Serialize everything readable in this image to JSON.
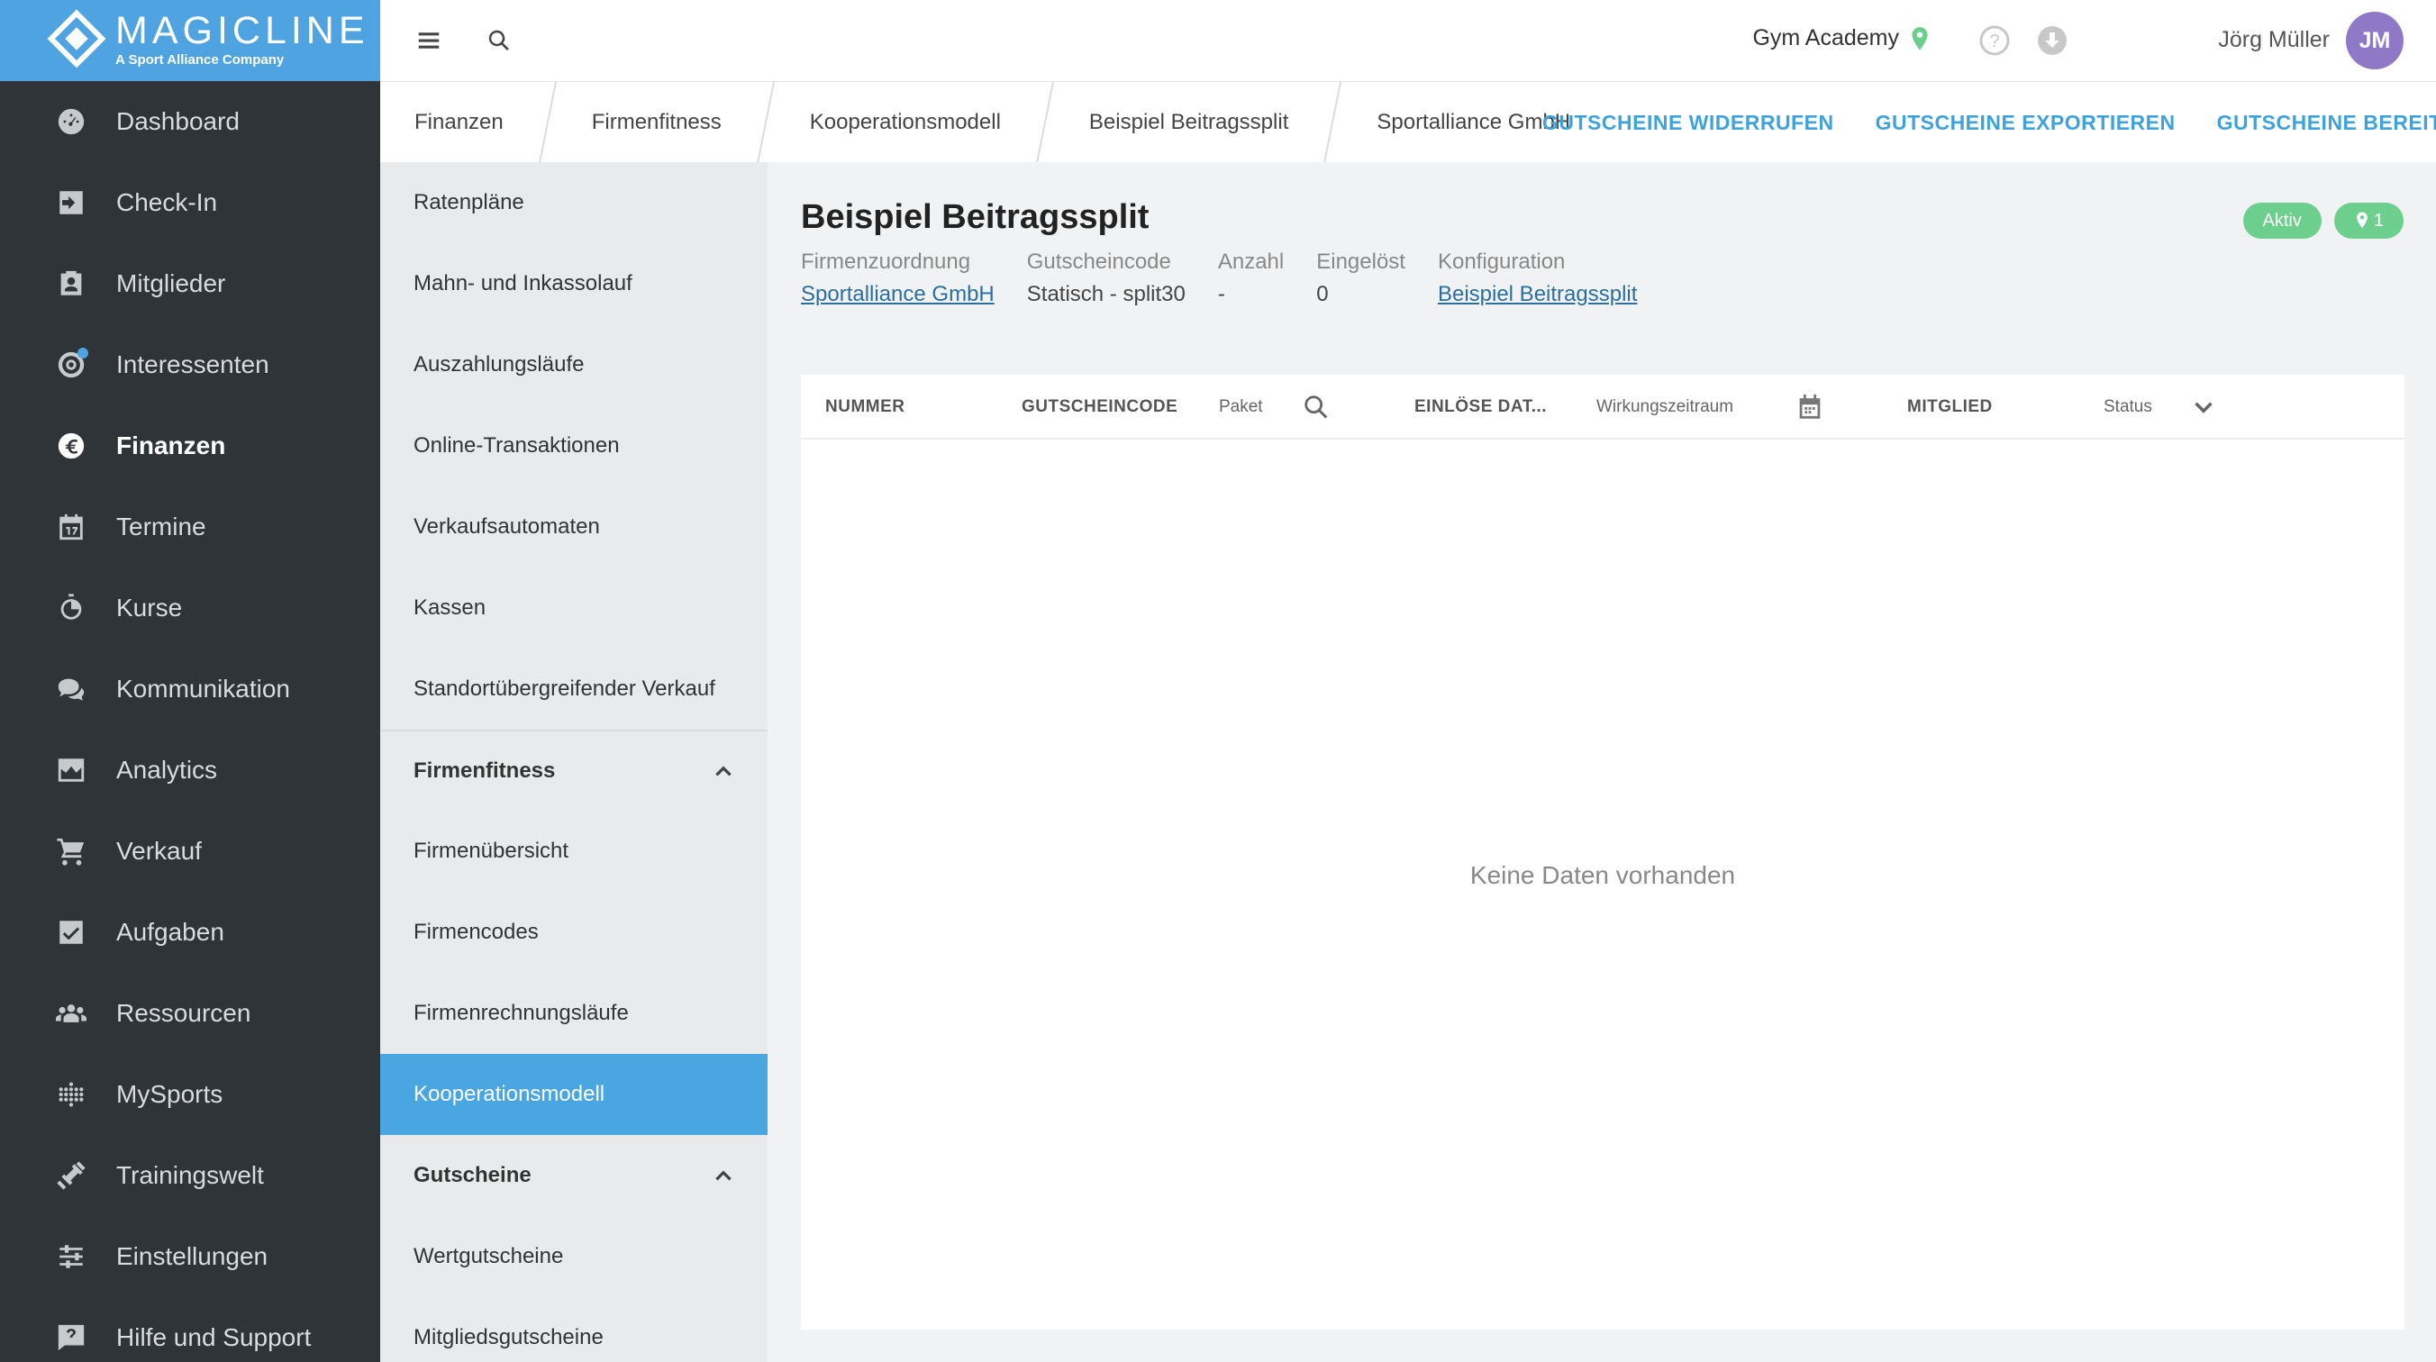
{
  "brand": {
    "name": "MAGICLINE",
    "tagline": "A Sport Alliance Company",
    "accent_color": "#4fa3e0"
  },
  "sidebar": {
    "items": [
      {
        "label": "Dashboard",
        "icon": "dashboard-icon"
      },
      {
        "label": "Check-In",
        "icon": "check-in-icon"
      },
      {
        "label": "Mitglieder",
        "icon": "members-icon"
      },
      {
        "label": "Interessenten",
        "icon": "leads-icon"
      },
      {
        "label": "Finanzen",
        "icon": "euro-icon",
        "active": true
      },
      {
        "label": "Termine",
        "icon": "calendar-icon"
      },
      {
        "label": "Kurse",
        "icon": "stopwatch-icon"
      },
      {
        "label": "Kommunikation",
        "icon": "chat-icon"
      },
      {
        "label": "Analytics",
        "icon": "chart-icon"
      },
      {
        "label": "Verkauf",
        "icon": "cart-icon"
      },
      {
        "label": "Aufgaben",
        "icon": "task-check-icon"
      },
      {
        "label": "Ressourcen",
        "icon": "people-icon"
      },
      {
        "label": "MySports",
        "icon": "mysports-icon"
      },
      {
        "label": "Trainingswelt",
        "icon": "dumbbell-icon"
      },
      {
        "label": "Einstellungen",
        "icon": "sliders-icon"
      },
      {
        "label": "Hilfe und Support",
        "icon": "help-chat-icon"
      }
    ]
  },
  "topbar": {
    "studio": "Gym Academy",
    "user_name": "Jörg Müller",
    "user_initials": "JM"
  },
  "breadcrumb": {
    "items": [
      "Finanzen",
      "Firmenfitness",
      "Kooperationsmodell",
      "Beispiel Beitragssplit",
      "Sportalliance GmbH"
    ]
  },
  "actions": {
    "revoke": "GUTSCHEINE WIDERRUFEN",
    "export": "GUTSCHEINE EXPORTIEREN",
    "provide": "GUTSCHEINE BEREITSTELLEN"
  },
  "subnav": {
    "finance_items": [
      "Ratenpläne",
      "Mahn- und Inkassolauf",
      "Auszahlungsläufe",
      "Online-Transaktionen",
      "Verkaufsautomaten",
      "Kassen",
      "Standortübergreifender Verkauf"
    ],
    "group_firmenfitness": "Firmenfitness",
    "firmenfitness_items": [
      "Firmenübersicht",
      "Firmencodes",
      "Firmenrechnungsläufe",
      "Kooperationsmodell"
    ],
    "group_gutscheine": "Gutscheine",
    "gutscheine_items": [
      "Wertgutscheine",
      "Mitgliedsgutscheine"
    ]
  },
  "page": {
    "title": "Beispiel Beitragssplit",
    "status_badge": "Aktiv",
    "location_count": "1",
    "meta": {
      "company_label": "Firmenzuordnung",
      "company_value": "Sportalliance GmbH",
      "code_label": "Gutscheincode",
      "code_value": "Statisch - split30",
      "count_label": "Anzahl",
      "count_value": "-",
      "redeemed_label": "Eingelöst",
      "redeemed_value": "0",
      "config_label": "Konfiguration",
      "config_value": "Beispiel Beitragssplit"
    }
  },
  "table": {
    "columns": {
      "number": "NUMMER",
      "code": "GUTSCHEINCODE",
      "package": "Paket",
      "redeem_date": "EINLÖSE DAT...",
      "period": "Wirkungszeitraum",
      "member": "MITGLIED",
      "status": "Status"
    },
    "empty_text": "Keine Daten vorhanden"
  }
}
